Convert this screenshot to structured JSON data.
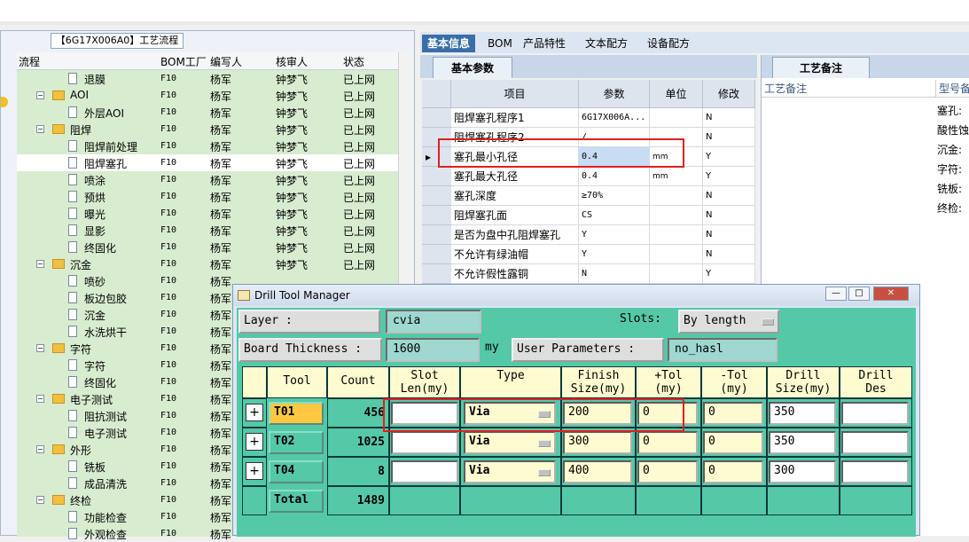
{
  "flow_panel": {
    "tab_title": "【6G17X006A0】工艺流程",
    "headers": [
      "流程",
      "BOM工厂",
      "编写人",
      "核审人",
      "状态"
    ],
    "rows": [
      {
        "name": "退膜",
        "level": 2,
        "bom": "F10",
        "writer": "杨军",
        "reviewer": "钟梦飞",
        "status": "已上网"
      },
      {
        "name": "AOI",
        "level": 1,
        "bom": "F10",
        "writer": "杨军",
        "reviewer": "钟梦飞",
        "status": "已上网"
      },
      {
        "name": "外层AOI",
        "level": 2,
        "bom": "F10",
        "writer": "杨军",
        "reviewer": "钟梦飞",
        "status": "已上网"
      },
      {
        "name": "阻焊",
        "level": 1,
        "bom": "F10",
        "writer": "杨军",
        "reviewer": "钟梦飞",
        "status": "已上网"
      },
      {
        "name": "阻焊前处理",
        "level": 2,
        "bom": "F10",
        "writer": "杨军",
        "reviewer": "钟梦飞",
        "status": "已上网"
      },
      {
        "name": "阻焊塞孔",
        "level": 2,
        "bom": "F10",
        "writer": "杨军",
        "reviewer": "钟梦飞",
        "status": "已上网",
        "selected": true
      },
      {
        "name": "喷涂",
        "level": 2,
        "bom": "F10",
        "writer": "杨军",
        "reviewer": "钟梦飞",
        "status": "已上网"
      },
      {
        "name": "预烘",
        "level": 2,
        "bom": "F10",
        "writer": "杨军",
        "reviewer": "钟梦飞",
        "status": "已上网"
      },
      {
        "name": "曝光",
        "level": 2,
        "bom": "F10",
        "writer": "杨军",
        "reviewer": "钟梦飞",
        "status": "已上网"
      },
      {
        "name": "显影",
        "level": 2,
        "bom": "F10",
        "writer": "杨军",
        "reviewer": "钟梦飞",
        "status": "已上网"
      },
      {
        "name": "终固化",
        "level": 2,
        "bom": "F10",
        "writer": "杨军",
        "reviewer": "钟梦飞",
        "status": "已上网"
      },
      {
        "name": "沉金",
        "level": 1,
        "bom": "F10",
        "writer": "杨军",
        "reviewer": "钟梦飞",
        "status": "已上网"
      },
      {
        "name": "喷砂",
        "level": 2,
        "bom": "F10",
        "writer": "杨军",
        "reviewer": "",
        "status": ""
      },
      {
        "name": "板边包胶",
        "level": 2,
        "bom": "F10",
        "writer": "杨军",
        "reviewer": "",
        "status": ""
      },
      {
        "name": "沉金",
        "level": 2,
        "bom": "F10",
        "writer": "杨军",
        "reviewer": "",
        "status": ""
      },
      {
        "name": "水洗烘干",
        "level": 2,
        "bom": "F10",
        "writer": "杨军",
        "reviewer": "",
        "status": ""
      },
      {
        "name": "字符",
        "level": 1,
        "bom": "F10",
        "writer": "杨军",
        "reviewer": "",
        "status": ""
      },
      {
        "name": "字符",
        "level": 2,
        "bom": "F10",
        "writer": "杨军",
        "reviewer": "",
        "status": ""
      },
      {
        "name": "终固化",
        "level": 2,
        "bom": "F10",
        "writer": "杨军",
        "reviewer": "",
        "status": ""
      },
      {
        "name": "电子测试",
        "level": 1,
        "bom": "F10",
        "writer": "杨军",
        "reviewer": "",
        "status": ""
      },
      {
        "name": "阻抗测试",
        "level": 2,
        "bom": "F10",
        "writer": "杨军",
        "reviewer": "",
        "status": ""
      },
      {
        "name": "电子测试",
        "level": 2,
        "bom": "F10",
        "writer": "杨军",
        "reviewer": "",
        "status": ""
      },
      {
        "name": "外形",
        "level": 1,
        "bom": "F10",
        "writer": "杨军",
        "reviewer": "",
        "status": ""
      },
      {
        "name": "铣板",
        "level": 2,
        "bom": "F10",
        "writer": "杨军",
        "reviewer": "",
        "status": ""
      },
      {
        "name": "成品清洗",
        "level": 2,
        "bom": "F10",
        "writer": "杨军",
        "reviewer": "",
        "status": ""
      },
      {
        "name": "终检",
        "level": 1,
        "bom": "F10",
        "writer": "杨军",
        "reviewer": "",
        "status": ""
      },
      {
        "name": "功能检查",
        "level": 2,
        "bom": "F10",
        "writer": "杨军",
        "reviewer": "",
        "status": ""
      },
      {
        "name": "外观检查",
        "level": 2,
        "bom": "F10",
        "writer": "杨军",
        "reviewer": "",
        "status": ""
      }
    ]
  },
  "right_tabs": [
    "基本信息",
    "BOM",
    "产品特性",
    "文本配方",
    "设备配方"
  ],
  "basic_params": {
    "subtab": "基本参数",
    "headers": [
      "项目",
      "参数",
      "单位",
      "修改"
    ],
    "rows": [
      {
        "item": "阻焊塞孔程序1",
        "value": "6G17X006A...",
        "unit": "",
        "mod": "N"
      },
      {
        "item": "阻焊塞孔程序2",
        "value": "/",
        "unit": "",
        "mod": "N"
      },
      {
        "item": "塞孔最小孔径",
        "value": "0.4",
        "unit": "mm",
        "mod": "Y",
        "current": true
      },
      {
        "item": "塞孔最大孔径",
        "value": "0.4",
        "unit": "mm",
        "mod": "Y"
      },
      {
        "item": "塞孔深度",
        "value": "≥70%",
        "unit": "",
        "mod": "N"
      },
      {
        "item": "阻焊塞孔面",
        "value": "CS",
        "unit": "",
        "mod": "N"
      },
      {
        "item": "是否为盘中孔阻焊塞孔",
        "value": "Y",
        "unit": "",
        "mod": "N"
      },
      {
        "item": "不允许有绿油帽",
        "value": "Y",
        "unit": "",
        "mod": "N"
      },
      {
        "item": "不允许假性露铜",
        "value": "N",
        "unit": "",
        "mod": "Y"
      }
    ]
  },
  "process_notes": {
    "tab": "工艺备注",
    "header": "工艺备注",
    "header2": "型号备注",
    "items": [
      "塞孔:",
      "酸性蚀",
      "沉金:",
      "字符:",
      "铣板:",
      "终检:"
    ]
  },
  "dialog": {
    "title": "Drill Tool Manager",
    "layer_label": "Layer        :",
    "layer_value": "cvia",
    "slots_label": "Slots:",
    "slots_value": "By length",
    "thickness_label": "Board Thickness :",
    "thickness_value": "1600",
    "thickness_unit": "my",
    "user_params_label": "User Parameters :",
    "user_params_value": "no_hasl",
    "columns": [
      "Tool",
      "Count",
      "Slot\nLen(my)",
      "Type",
      "Finish\nSize(my)",
      "+Tol\n(my)",
      "-Tol\n(my)",
      "Drill\nSize(my)",
      "Drill\nDes"
    ],
    "tools": [
      {
        "tool": "T01",
        "count": "456",
        "slot": "",
        "type": "Via",
        "finish": "200",
        "ptol": "0",
        "mtol": "0",
        "drill": "350",
        "des": ""
      },
      {
        "tool": "T02",
        "count": "1025",
        "slot": "",
        "type": "Via",
        "finish": "300",
        "ptol": "0",
        "mtol": "0",
        "drill": "350",
        "des": ""
      },
      {
        "tool": "T04",
        "count": "8",
        "slot": "",
        "type": "Via",
        "finish": "400",
        "ptol": "0",
        "mtol": "0",
        "drill": "300",
        "des": ""
      }
    ],
    "total_label": "Total",
    "total_count": "1489"
  }
}
